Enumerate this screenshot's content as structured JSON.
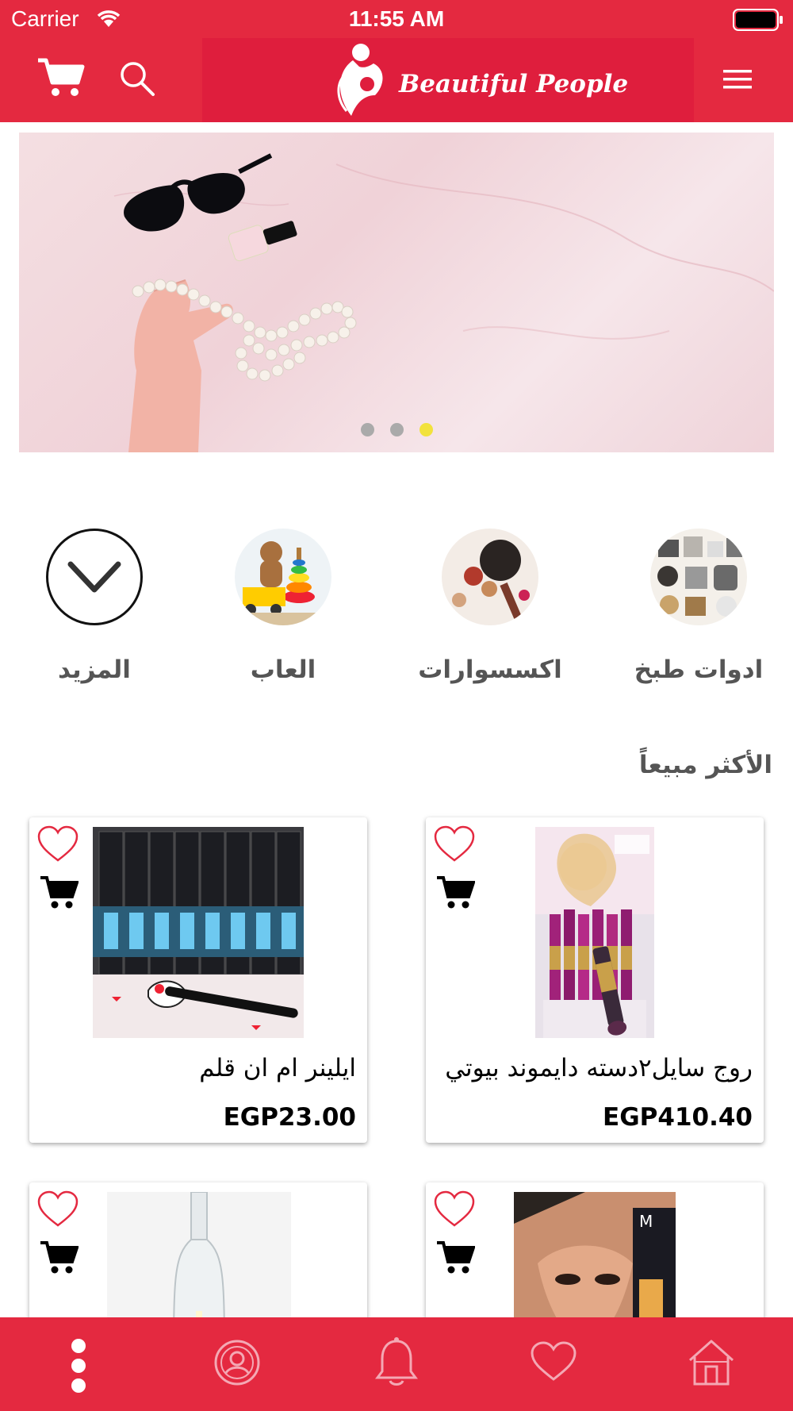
{
  "status_bar": {
    "carrier": "Carrier",
    "time": "11:55 AM"
  },
  "header": {
    "logo_text": "Beautiful People"
  },
  "banner": {
    "slide_count": 3,
    "active_slide": 3
  },
  "categories": [
    {
      "label": "ادوات طبخ"
    },
    {
      "label": "اكسسوارات"
    },
    {
      "label": "العاب"
    },
    {
      "label": "المزيد"
    }
  ],
  "best_sellers": {
    "title": "الأكثر مبيعاً",
    "products": [
      {
        "name": "روج سايل٢دسته دايموند بيوتي",
        "price": "EGP410.40"
      },
      {
        "name": "ايلينر ام ان قلم",
        "price": "EGP23.00"
      },
      {
        "name": "",
        "price": ""
      },
      {
        "name": "",
        "price": ""
      }
    ]
  },
  "tab_bar": {
    "items": [
      {
        "icon": "more-vertical-icon"
      },
      {
        "icon": "profile-icon"
      },
      {
        "icon": "bell-icon"
      },
      {
        "icon": "heart-icon"
      },
      {
        "icon": "home-icon"
      }
    ]
  },
  "colors": {
    "primary": "#E42940",
    "logo_bg": "#DF1E3D",
    "active_dot": "#F2E23C"
  }
}
